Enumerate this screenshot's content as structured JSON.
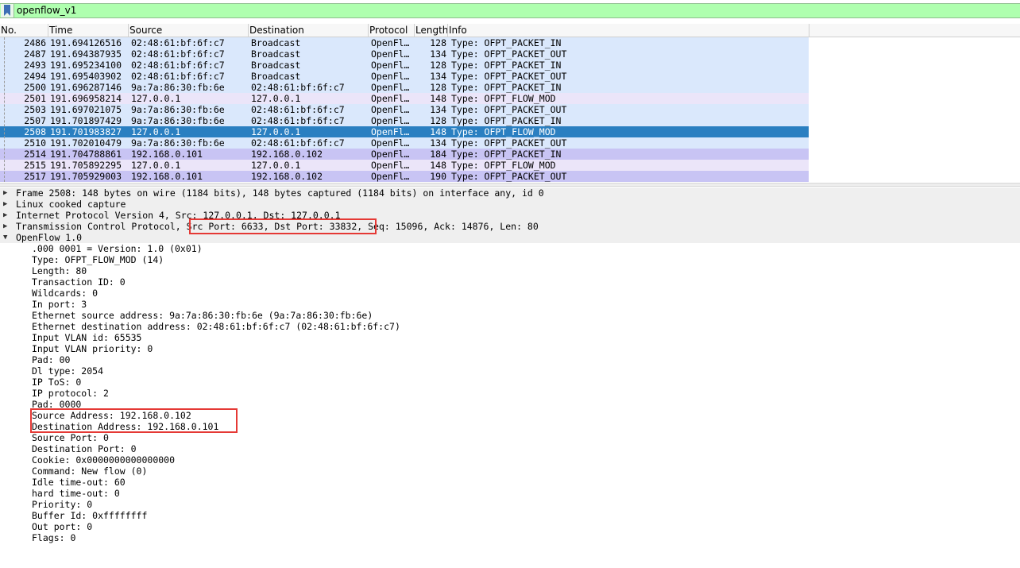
{
  "filter": {
    "icon": "bookmark-icon",
    "value": "openflow_v1"
  },
  "columns": [
    "No.",
    "Time",
    "Source",
    "Destination",
    "Protocol",
    "Length",
    "Info"
  ],
  "packets": [
    {
      "no": "2486",
      "time": "191.694126516",
      "src": "02:48:61:bf:6f:c7",
      "dst": "Broadcast",
      "proto": "OpenFl…",
      "len": "128",
      "info": "Type: OFPT_PACKET_IN",
      "color": "#dae8fc"
    },
    {
      "no": "2487",
      "time": "191.694387935",
      "src": "02:48:61:bf:6f:c7",
      "dst": "Broadcast",
      "proto": "OpenFl…",
      "len": "134",
      "info": "Type: OFPT_PACKET_OUT",
      "color": "#dae8fc"
    },
    {
      "no": "2493",
      "time": "191.695234100",
      "src": "02:48:61:bf:6f:c7",
      "dst": "Broadcast",
      "proto": "OpenFl…",
      "len": "128",
      "info": "Type: OFPT_PACKET_IN",
      "color": "#dae8fc"
    },
    {
      "no": "2494",
      "time": "191.695403902",
      "src": "02:48:61:bf:6f:c7",
      "dst": "Broadcast",
      "proto": "OpenFl…",
      "len": "134",
      "info": "Type: OFPT_PACKET_OUT",
      "color": "#dae8fc"
    },
    {
      "no": "2500",
      "time": "191.696287146",
      "src": "9a:7a:86:30:fb:6e",
      "dst": "02:48:61:bf:6f:c7",
      "proto": "OpenFl…",
      "len": "128",
      "info": "Type: OFPT_PACKET_IN",
      "color": "#dae8fc"
    },
    {
      "no": "2501",
      "time": "191.696958214",
      "src": "127.0.0.1",
      "dst": "127.0.0.1",
      "proto": "OpenFl…",
      "len": "148",
      "info": "Type: OFPT_FLOW_MOD",
      "color": "#ebe5f9"
    },
    {
      "no": "2503",
      "time": "191.697021075",
      "src": "9a:7a:86:30:fb:6e",
      "dst": "02:48:61:bf:6f:c7",
      "proto": "OpenFl…",
      "len": "134",
      "info": "Type: OFPT_PACKET_OUT",
      "color": "#dae8fc"
    },
    {
      "no": "2507",
      "time": "191.701897429",
      "src": "9a:7a:86:30:fb:6e",
      "dst": "02:48:61:bf:6f:c7",
      "proto": "OpenFl…",
      "len": "128",
      "info": "Type: OFPT_PACKET_IN",
      "color": "#dae8fc"
    },
    {
      "no": "2508",
      "time": "191.701983827",
      "src": "127.0.0.1",
      "dst": "127.0.0.1",
      "proto": "OpenFl…",
      "len": "148",
      "info": "Type: OFPT_FLOW_MOD",
      "color": "#2a7fc1",
      "selected": true
    },
    {
      "no": "2510",
      "time": "191.702010479",
      "src": "9a:7a:86:30:fb:6e",
      "dst": "02:48:61:bf:6f:c7",
      "proto": "OpenFl…",
      "len": "134",
      "info": "Type: OFPT_PACKET_OUT",
      "color": "#dae8fc"
    },
    {
      "no": "2514",
      "time": "191.704788861",
      "src": "192.168.0.101",
      "dst": "192.168.0.102",
      "proto": "OpenFl…",
      "len": "184",
      "info": "Type: OFPT_PACKET_IN",
      "color": "#c8c4f4"
    },
    {
      "no": "2515",
      "time": "191.705892295",
      "src": "127.0.0.1",
      "dst": "127.0.0.1",
      "proto": "OpenFl…",
      "len": "148",
      "info": "Type: OFPT_FLOW_MOD",
      "color": "#ebe5f9"
    },
    {
      "no": "2517",
      "time": "191.705929003",
      "src": "192.168.0.101",
      "dst": "192.168.0.102",
      "proto": "OpenFl…",
      "len": "190",
      "info": "Type: OFPT_PACKET_OUT",
      "color": "#c8c4f4"
    }
  ],
  "details": {
    "frame": "Frame 2508: 148 bytes on wire (1184 bits), 148 bytes captured (1184 bits) on interface any, id 0",
    "linux": "Linux cooked capture",
    "ip": "Internet Protocol Version 4, Src: 127.0.0.1, Dst: 127.0.0.1",
    "tcp_a": "Transmission Control Protocol, ",
    "tcp_b": "Src Port: 6633, Dst Port: 33832,",
    "tcp_c": " Seq: 15096, Ack: 14876, Len: 80",
    "openflow": "OpenFlow 1.0",
    "fields": [
      ".000 0001 = Version: 1.0 (0x01)",
      "Type: OFPT_FLOW_MOD (14)",
      "Length: 80",
      "Transaction ID: 0",
      "Wildcards: 0",
      "In port: 3",
      "Ethernet source address: 9a:7a:86:30:fb:6e (9a:7a:86:30:fb:6e)",
      "Ethernet destination address: 02:48:61:bf:6f:c7 (02:48:61:bf:6f:c7)",
      "Input VLAN id: 65535",
      "Input VLAN priority: 0",
      "Pad: 00",
      "Dl type: 2054",
      "IP ToS: 0",
      "IP protocol: 2",
      "Pad: 0000",
      "Source Address: 192.168.0.102",
      "Destination Address: 192.168.0.101",
      "Source Port: 0",
      "Destination Port: 0",
      "Cookie: 0x0000000000000000",
      "Command: New flow (0)",
      "Idle time-out: 60",
      "hard time-out: 0",
      "Priority: 0",
      "Buffer Id: 0xffffffff",
      "Out port: 0",
      "Flags: 0"
    ]
  },
  "colors": {
    "filter_bg": "#afffaf",
    "selected": "#2a7fc1",
    "highlight": "#e53935"
  }
}
